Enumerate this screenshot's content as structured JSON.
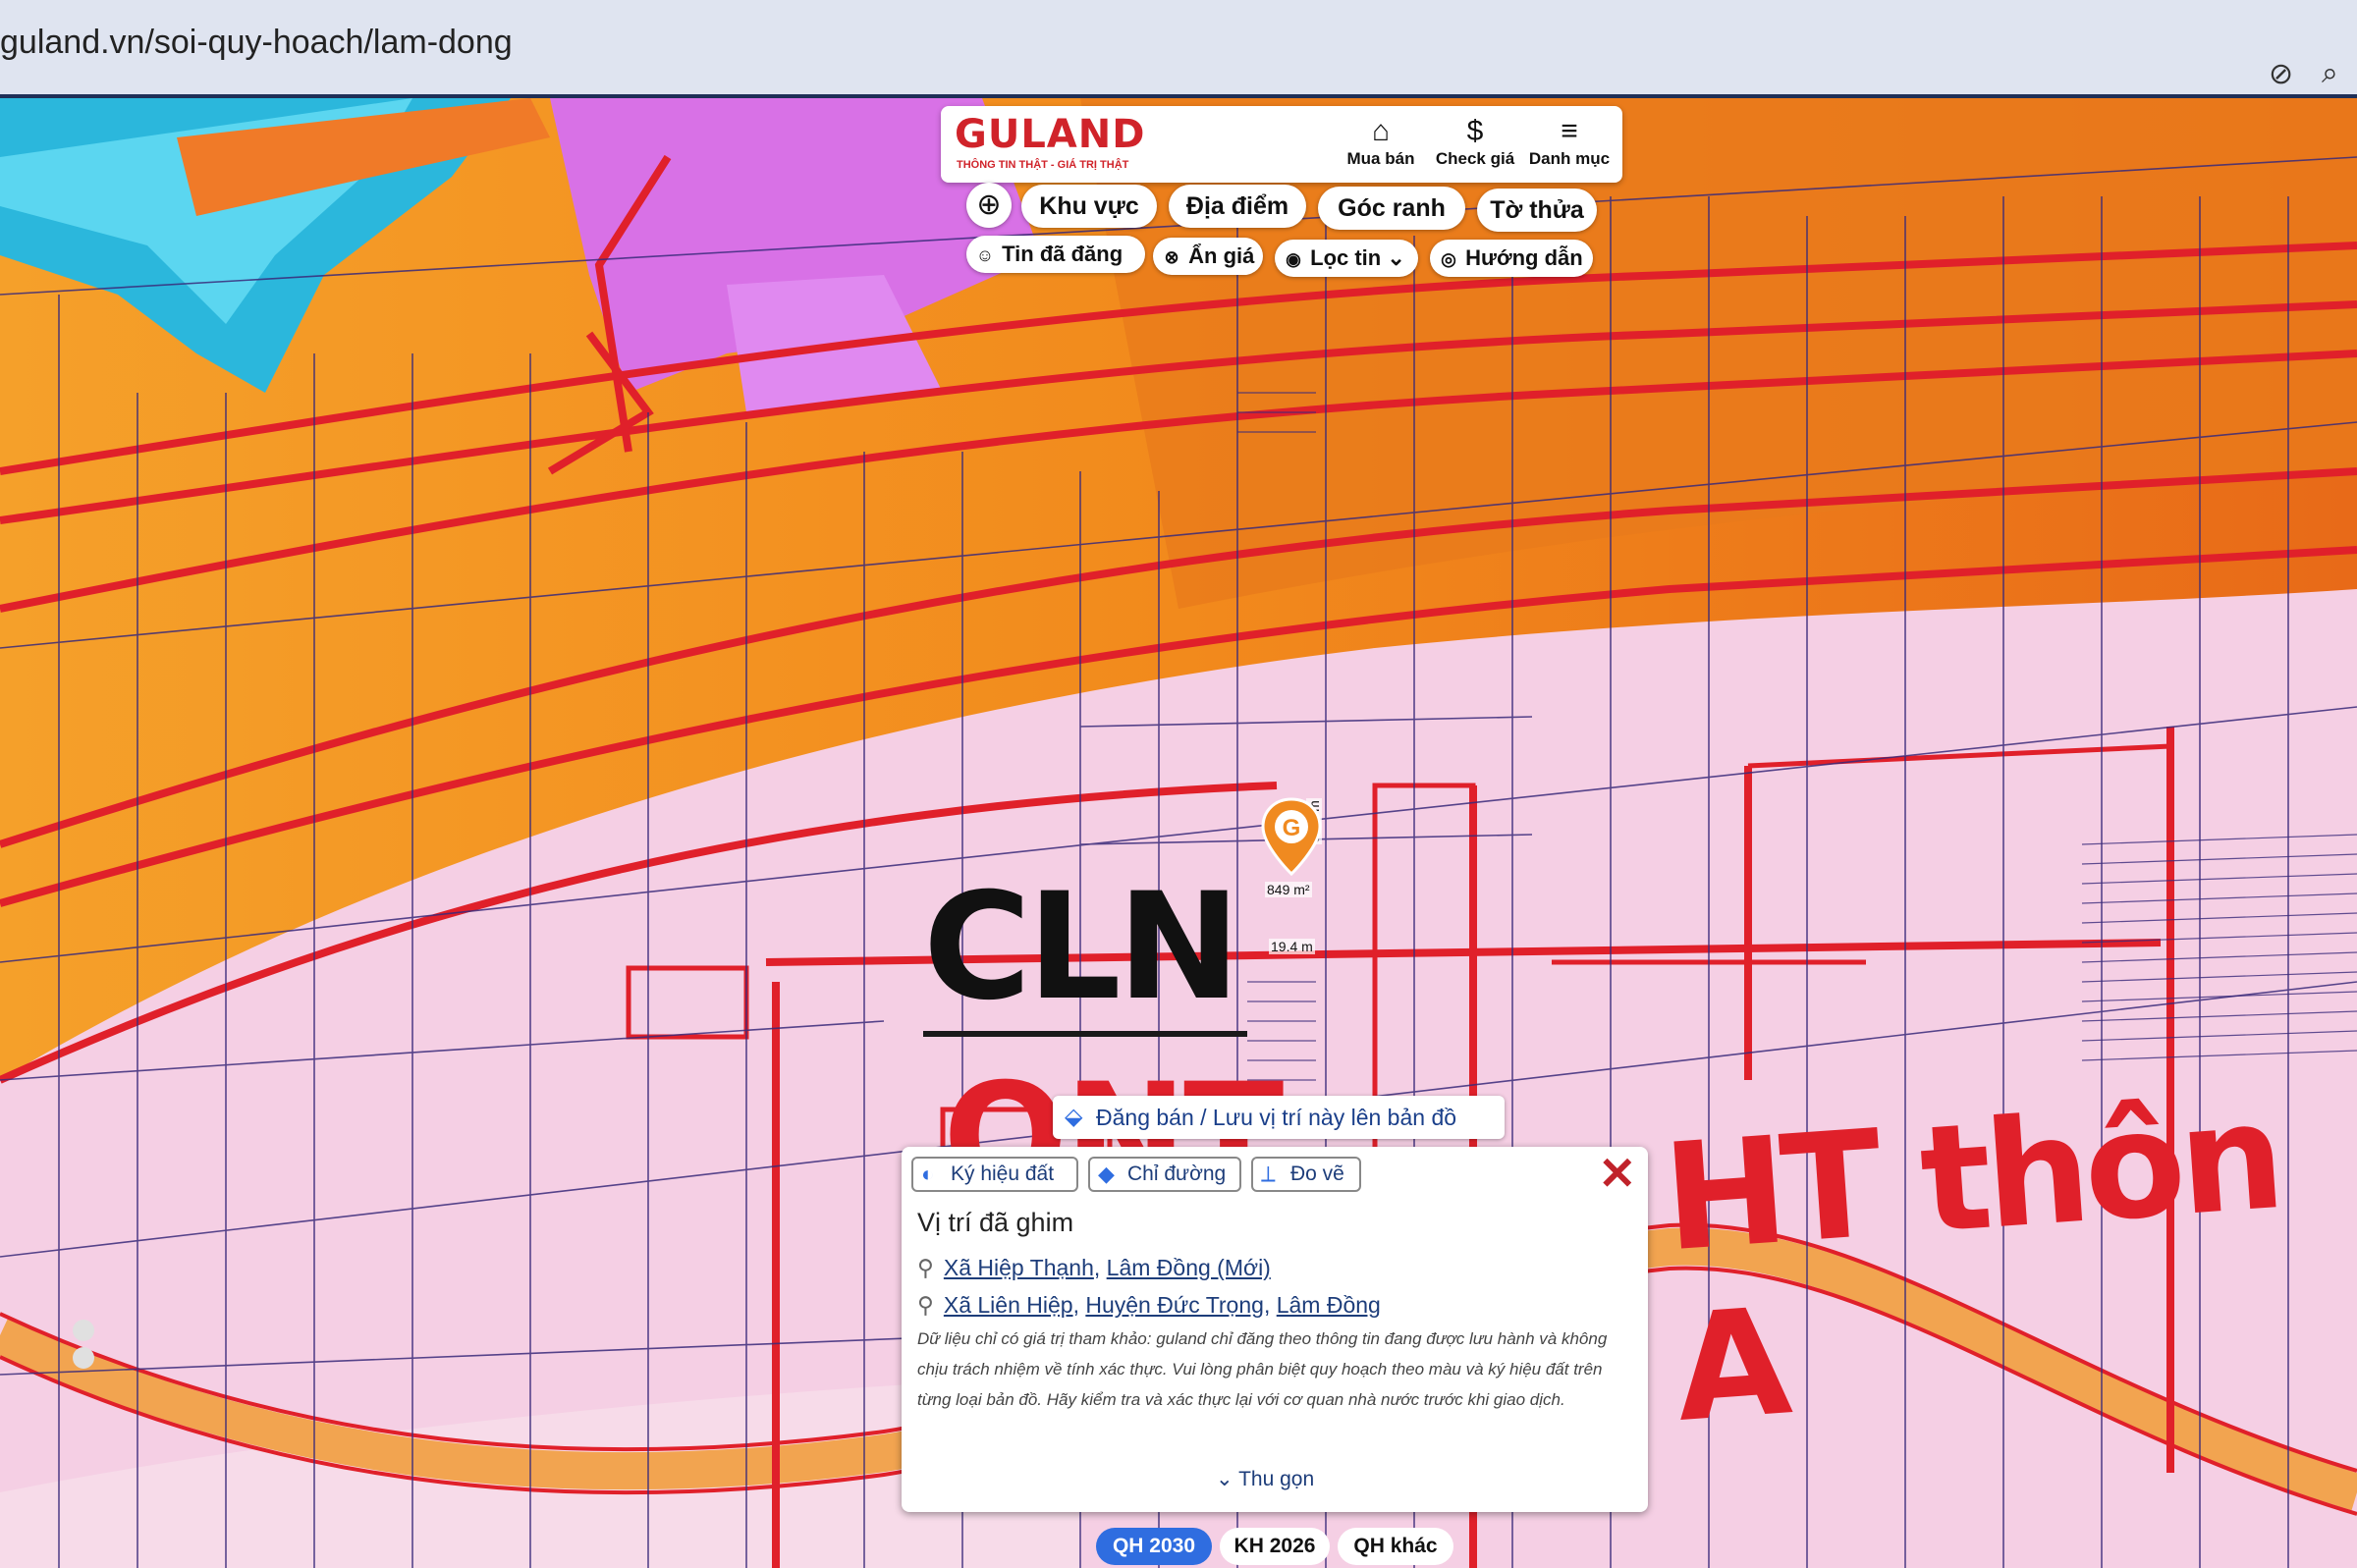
{
  "browser": {
    "url": "guland.vn/soi-quy-hoach/lam-dong",
    "icons": [
      "eye-off-icon",
      "zoom-icon"
    ]
  },
  "brand": {
    "logo": "GULAND",
    "tagline": "THÔNG TIN THẬT - GIÁ TRỊ THẬT"
  },
  "top_actions": [
    {
      "icon": "house-icon",
      "label": "Mua bán"
    },
    {
      "icon": "dollar-icon",
      "label": "Check giá"
    },
    {
      "icon": "menu-icon",
      "label": "Danh mục"
    }
  ],
  "primary_tabs": [
    "Khu vực",
    "Địa điểm",
    "Góc ranh",
    "Tờ thửa"
  ],
  "secondary_tabs": [
    "Tin đã đăng",
    "Ẩn giá",
    "Lọc tin",
    "Hướng dẫn"
  ],
  "map": {
    "zone_labels": [
      "CLN",
      "ONT",
      "HT thôn A"
    ],
    "measure_labels": [
      "849 m²",
      "35.5 m",
      "19.4 m"
    ],
    "colors": {
      "orange": "#f08a20",
      "pink": "#f3c6e0",
      "red_line": "#e0202a",
      "blue_water": "#3fc6e6",
      "purple": "#d060e0"
    }
  },
  "post_bar": {
    "label": "Đăng bán / Lưu vị trí này lên bản đồ"
  },
  "info_panel": {
    "tools": [
      "Ký hiệu đất",
      "Chỉ đường",
      "Đo vẽ"
    ],
    "title": "Vị trí đã ghim",
    "address1": {
      "commune": "Xã Hiệp Thạnh",
      "province": "Lâm Đồng (Mới)"
    },
    "address2": {
      "commune": "Xã Liên Hiệp",
      "district": "Huyện Đức Trọng",
      "province": "Lâm Đồng"
    },
    "disclaimer": "Dữ liệu chỉ có giá trị tham khảo: guland chỉ đăng theo thông tin đang được lưu hành và không chịu trách nhiệm về tính xác thực. Vui lòng phân biệt quy hoạch theo màu và ký hiệu đất trên từng loại bản đồ. Hãy kiểm tra và xác thực lại với cơ quan nhà nước trước khi giao dịch.",
    "collapse_label": "Thu gọn"
  },
  "plan_tabs": [
    {
      "label": "QH 2030",
      "active": true
    },
    {
      "label": "KH 2026",
      "active": false
    },
    {
      "label": "QH khác",
      "active": false
    }
  ]
}
